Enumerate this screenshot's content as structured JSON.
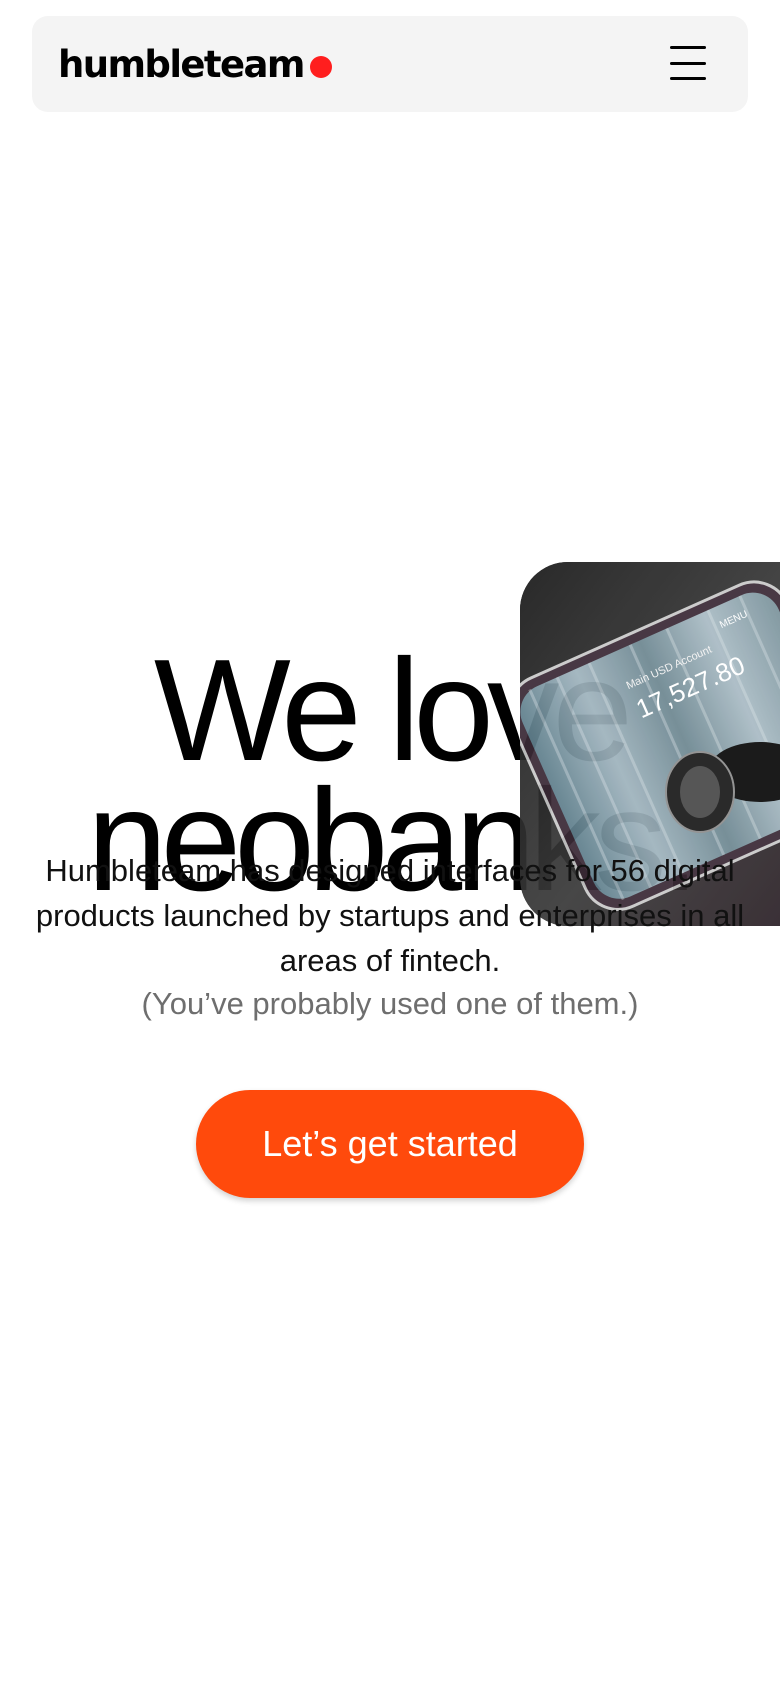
{
  "header": {
    "logo_text": "humbleteam",
    "logo_dot_color": "#ff1e1e",
    "menu_icon": "hamburger-menu-icon"
  },
  "hero": {
    "title_line1": "We love",
    "title_line2": "neobanks.",
    "description": "Humbleteam has designed interfaces for 56 digital products launched by startups and enterprises in all areas of fintech.",
    "note": "(You’ve probably used one of them.)",
    "cta_label": "Let’s get started",
    "cta_color": "#ff4a0c",
    "phone_image": {
      "balance": "17,527.80",
      "account_label": "Main USD Account",
      "menu_label": "MENU"
    }
  }
}
